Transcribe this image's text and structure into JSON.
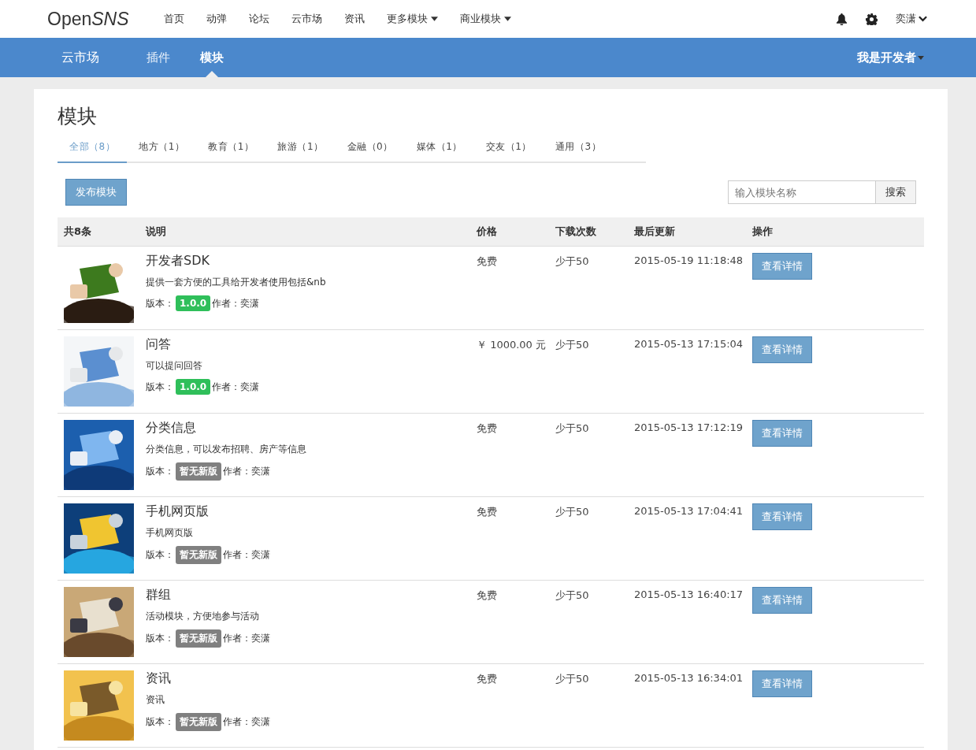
{
  "logo": {
    "regular": "Open",
    "italic": "SNS"
  },
  "nav": [
    {
      "label": "首页",
      "dropdown": false
    },
    {
      "label": "动弹",
      "dropdown": false
    },
    {
      "label": "论坛",
      "dropdown": false
    },
    {
      "label": "云市场",
      "dropdown": false
    },
    {
      "label": "资讯",
      "dropdown": false
    },
    {
      "label": "更多模块",
      "dropdown": true
    },
    {
      "label": "商业模块",
      "dropdown": true
    }
  ],
  "user": {
    "name": "奕潇"
  },
  "subnav": {
    "title": "云市场",
    "items": [
      {
        "label": "插件",
        "selected": false
      },
      {
        "label": "模块",
        "selected": true
      }
    ],
    "developer": "我是开发者"
  },
  "page": {
    "title": "模块",
    "tabs": [
      {
        "label": "全部（8）",
        "selected": true
      },
      {
        "label": "地方（1）",
        "selected": false
      },
      {
        "label": "教育（1）",
        "selected": false
      },
      {
        "label": "旅游（1）",
        "selected": false
      },
      {
        "label": "金融（0）",
        "selected": false
      },
      {
        "label": "媒体（1）",
        "selected": false
      },
      {
        "label": "交友（1）",
        "selected": false
      },
      {
        "label": "通用（3）",
        "selected": false
      }
    ],
    "publish_button": "发布模块",
    "search": {
      "placeholder": "输入模块名称",
      "button": "搜索"
    }
  },
  "table": {
    "columns": [
      "共8条",
      "说明",
      "价格",
      "下载次数",
      "最后更新",
      "操作"
    ],
    "rows": [
      {
        "name": "开发者SDK",
        "description": "提供一套方便的工具给开发者使用包括&nb",
        "version_label": "版本：",
        "version": {
          "text": "1.0.0",
          "kind": "release"
        },
        "author": "作者：奕潇",
        "price": "免费",
        "downloads": "少于50",
        "updated": "2015-05-19 11:18:48",
        "action": "查看详情"
      },
      {
        "name": "问答",
        "description": "可以提问回答",
        "version_label": "版本：",
        "version": {
          "text": "1.0.0",
          "kind": "release"
        },
        "author": "作者：奕潇",
        "price": "￥ 1000.00 元",
        "downloads": "少于50",
        "updated": "2015-05-13 17:15:04",
        "action": "查看详情"
      },
      {
        "name": "分类信息",
        "description": "分类信息，可以发布招聘、房产等信息",
        "version_label": "版本：",
        "version": {
          "text": "暂无新版",
          "kind": "none"
        },
        "author": "作者：奕潇",
        "price": "免费",
        "downloads": "少于50",
        "updated": "2015-05-13 17:12:19",
        "action": "查看详情"
      },
      {
        "name": "手机网页版",
        "description": "手机网页版",
        "version_label": "版本：",
        "version": {
          "text": "暂无新版",
          "kind": "none"
        },
        "author": "作者：奕潇",
        "price": "免费",
        "downloads": "少于50",
        "updated": "2015-05-13 17:04:41",
        "action": "查看详情"
      },
      {
        "name": "群组",
        "description": "活动模块，方便地参与活动",
        "version_label": "版本：",
        "version": {
          "text": "暂无新版",
          "kind": "none"
        },
        "author": "作者：奕潇",
        "price": "免费",
        "downloads": "少于50",
        "updated": "2015-05-13 16:40:17",
        "action": "查看详情"
      },
      {
        "name": "资讯",
        "description": "资讯",
        "version_label": "版本：",
        "version": {
          "text": "暂无新版",
          "kind": "none"
        },
        "author": "作者：奕潇",
        "price": "免费",
        "downloads": "少于50",
        "updated": "2015-05-13 16:34:01",
        "action": "查看详情"
      }
    ]
  }
}
